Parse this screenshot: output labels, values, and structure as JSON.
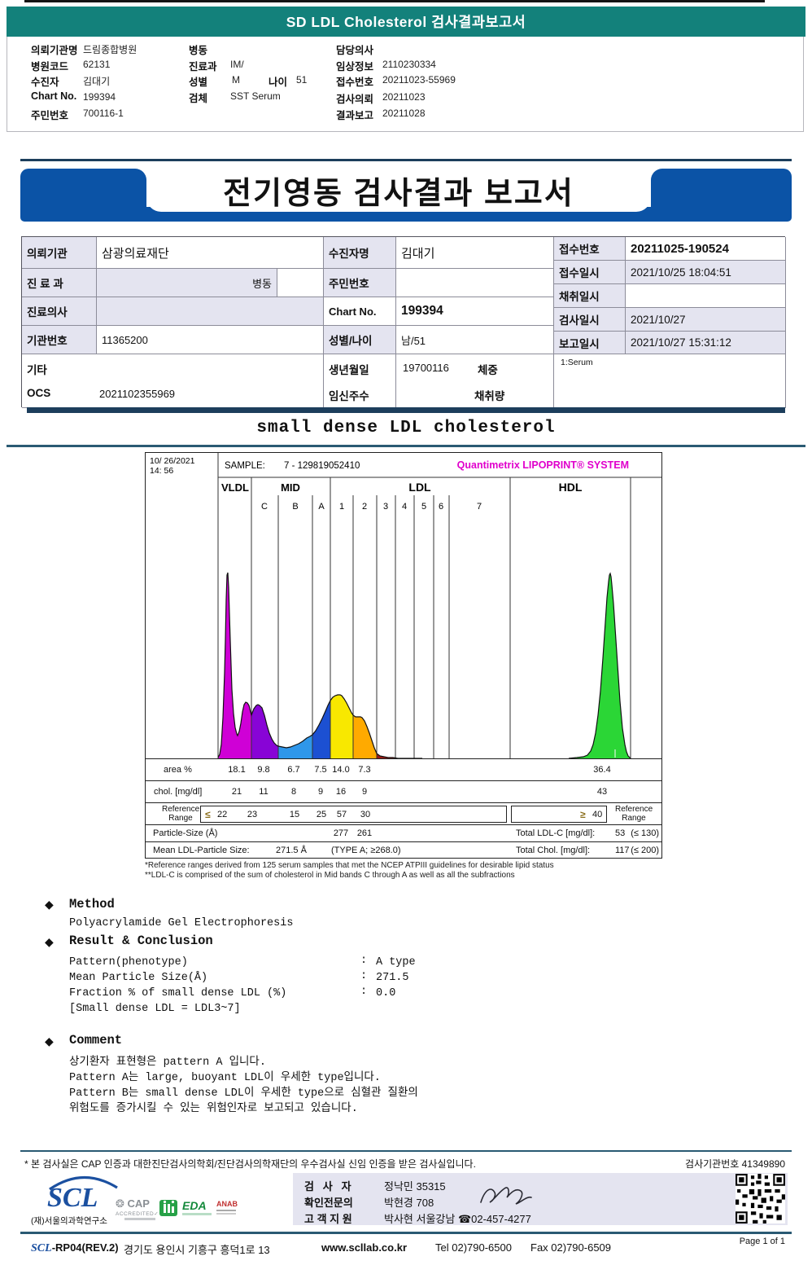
{
  "header": {
    "title": "SD LDL Cholesterol 검사결과보고서",
    "col1": [
      {
        "label": "의뢰기관명",
        "value": "드림종합병원"
      },
      {
        "label": "병원코드",
        "value": "62131"
      },
      {
        "label": "수진자",
        "value": "김대기"
      },
      {
        "label": "Chart No.",
        "value": "199394"
      },
      {
        "label": "주민번호",
        "value": "700116-1"
      }
    ],
    "col2": [
      {
        "label": "병동",
        "value": ""
      },
      {
        "label": "진료과",
        "value": "IM/"
      },
      {
        "label": "성별",
        "value": "M"
      },
      {
        "label": "나이",
        "value": "51"
      },
      {
        "label": "검체",
        "value": "SST Serum"
      }
    ],
    "col3": [
      {
        "label": "담당의사",
        "value": ""
      },
      {
        "label": "임상정보",
        "value": "2110230334"
      },
      {
        "label": "접수번호",
        "value": "20211023-55969"
      },
      {
        "label": "검사의뢰",
        "value": "20211023"
      },
      {
        "label": "결과보고",
        "value": "20211028"
      }
    ]
  },
  "banner": {
    "title": "전기영동 검사결과 보고서"
  },
  "info": {
    "r1c1_label": "의뢰기관",
    "r1c1_value": "삼광의료재단",
    "r2c1_label": "진 료 과",
    "r2c1_value": "병동",
    "r3c1_label": "진료의사",
    "r3c1_value": "",
    "r4c1_label": "기관번호",
    "r4c1_value": "11365200",
    "gita_label": "기타",
    "ocs_label": "OCS",
    "ocs_value": "2021102355969",
    "r1c2_label": "수진자명",
    "r1c2_value": "김대기",
    "r2c2_label": "주민번호",
    "r2c2_value": "",
    "r3c2_label": "Chart No.",
    "r3c2_value": "199394",
    "r4c2_label": "성별/나이",
    "r4c2_value": "남/51",
    "birth_label": "생년월일",
    "birth_value": "19700116",
    "weight_label": "체중",
    "preg_label": "임신주수",
    "volume_label": "채취량",
    "serum_note": "1:Serum",
    "r1c3_label": "접수번호",
    "r1c3_value": "20211025-190524",
    "r2c3_label": "접수일시",
    "r2c3_value": "2021/10/25 18:04:51",
    "r3c3_label": "채취일시",
    "r3c3_value": "",
    "r4c3_label": "검사일시",
    "r4c3_value": "2021/10/27",
    "r5c3_label": "보고일시",
    "r5c3_value": "2021/10/27 15:31:12"
  },
  "section": {
    "title": "small dense LDL cholesterol"
  },
  "chart_data": {
    "type": "area",
    "title": "Quantimetrix LIPOPRINT® SYSTEM",
    "datetime1": "10/ 26/2021",
    "datetime2": "14: 56",
    "sample_label": "SAMPLE:",
    "sample_value": "7 - 129819052410",
    "bands": [
      "VLDL",
      "MID C",
      "MID B",
      "MID A",
      "LDL 1",
      "LDL 2",
      "LDL 3",
      "LDL 4",
      "LDL 5",
      "LDL 6",
      "LDL 7",
      "HDL"
    ],
    "band_headers": {
      "vldl": "VLDL",
      "mid": "MID",
      "ldl": "LDL",
      "hdl": "HDL"
    },
    "sub_labels": [
      "C",
      "B",
      "A",
      "1",
      "2",
      "3",
      "4",
      "5",
      "6",
      "7"
    ],
    "series": [
      {
        "name": "area %",
        "values": [
          18.1,
          9.8,
          6.7,
          7.5,
          14.0,
          7.3,
          null,
          null,
          null,
          null,
          null,
          36.4
        ]
      },
      {
        "name": "chol. [mg/dl]",
        "values": [
          21,
          11,
          8,
          9,
          16,
          9,
          null,
          null,
          null,
          null,
          null,
          43
        ]
      },
      {
        "name": "Reference Range",
        "values": [
          "≤22",
          "23",
          "15",
          "25",
          "57",
          "30",
          null,
          null,
          null,
          null,
          null,
          "≥40"
        ]
      }
    ],
    "particle_size_A": {
      "LDL1": 277,
      "LDL2": 261
    },
    "band_colors": {
      "VLDL": "#cf00d6",
      "MID C": "#8804d6",
      "MID B": "#2f97ea",
      "MID A": "#1c50d2",
      "LDL 1": "#f8e800",
      "LDL 2": "#ffaa00",
      "LDL 3": "#9c1a14",
      "HDL": "#2bd636"
    },
    "grid": "vertical band dividers",
    "legend_position": "none",
    "display": {
      "area": [
        "18.1",
        "9.8",
        "6.7",
        "7.5",
        "14.0",
        "7.3",
        "36.4"
      ],
      "chol": [
        "21",
        "11",
        "8",
        "9",
        "16",
        "9",
        "43"
      ],
      "ref": [
        "22",
        "23",
        "15",
        "25",
        "57",
        "30"
      ],
      "ref_hdl": "40",
      "particle": [
        "277",
        "261"
      ]
    },
    "labels": {
      "area_label": "area %",
      "chol_label": "chol. [mg/dl]",
      "ref1": "Reference",
      "ref2": "Range",
      "le": "≤",
      "ge": "≥",
      "particle_label": "Particle-Size (Å)",
      "total_ldl_label": "Total LDL-C [mg/dl]:",
      "total_ldl_value": "53",
      "total_ldl_ref": "(≤ 130)",
      "mean_label": "Mean LDL-Particle Size:",
      "mean_value": "271.5 Å",
      "mean_type": "(TYPE A; ≥268.0)",
      "total_chol_label": "Total Chol. [mg/dl]:",
      "total_chol_value": "117",
      "total_chol_ref": "(≤ 200)"
    }
  },
  "footnotes": {
    "line1": "*Reference ranges derived from 125 serum samples that met the NCEP ATPIII guidelines for desirable lipid status",
    "line2": "**LDL-C is comprised of the sum of cholesterol in Mid bands C through A as well as all the subfractions"
  },
  "method": {
    "heading": "Method",
    "body": "Polyacrylamide Gel Electrophoresis"
  },
  "result": {
    "heading": "Result & Conclusion",
    "rows": [
      {
        "label": "Pattern(phenotype)",
        "colon": ":",
        "value": "A type"
      },
      {
        "label": "Mean Particle Size(Å)",
        "colon": ":",
        "value": "271.5"
      },
      {
        "label": "Fraction % of small dense LDL (%)",
        "colon": ":",
        "value": "0.0"
      }
    ],
    "note": "[Small dense LDL = LDL3~7]"
  },
  "comment": {
    "heading": "Comment",
    "lines": [
      "상기환자 표현형은 pattern A 입니다.",
      "Pattern A는 large, buoyant LDL이 우세한 type입니다.",
      "Pattern B는 small dense LDL이 우세한 type으로 심혈관 질환의",
      "위험도를 증가시킬 수 있는 위험인자로 보고되고 있습니다."
    ]
  },
  "footer": {
    "cert_note": "* 본 검사실은 CAP 인증과 대한진단검사의학회/진단검사의학재단의 우수검사실 신임 인증을 받은 검사실입니다.",
    "org_no": "검사기관번호 41349890",
    "rows": [
      {
        "label": "검   사   자",
        "value": "정낙민 35315"
      },
      {
        "label": "확인전문의",
        "value": "박현경 708"
      },
      {
        "label": "고 객 지 원",
        "value": "박사현 서울강남 ☎02-457-4277"
      }
    ],
    "scl": "SCL",
    "scl_org": "(재)서울의과학연구소",
    "cap1": "CAP",
    "cap2": "ACCREDITED",
    "eda": "EDA",
    "anab": "ANAB",
    "doc_no_scl": "SCL",
    "doc_no_rest": "-RP04(REV.2)",
    "address": "경기도 용인시 기흥구 흥덕1로 13",
    "website": "www.scllab.co.kr",
    "tel": "Tel 02)790-6500",
    "fax": "Fax 02)790-6509",
    "page": "Page 1 of 1"
  }
}
